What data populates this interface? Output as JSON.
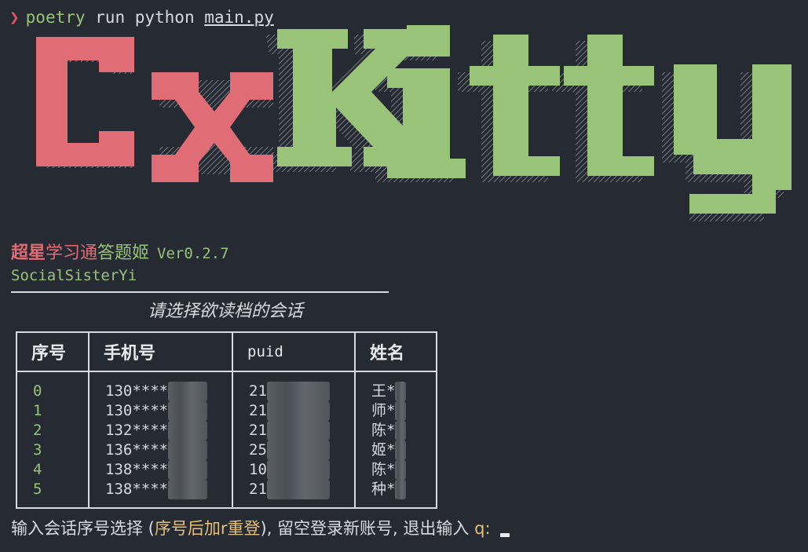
{
  "command": {
    "prompt_glyph": "❯",
    "poetry": "poetry",
    "rest": " run python ",
    "file": "main.py"
  },
  "banner": {
    "word_left": "Cx",
    "word_right": "Kitty",
    "color_left": "#e06c75",
    "color_right": "#98c379"
  },
  "app": {
    "title_part1": "超星",
    "title_part2": "学习通",
    "title_part3": "答题姬",
    "version": "Ver0.2.7",
    "author": "SocialSisterYi"
  },
  "table": {
    "caption": "请选择欲读档的会话",
    "headers": [
      "序号",
      "手机号",
      "puid",
      "姓名"
    ],
    "rows": [
      {
        "index": "0",
        "phone": "130****",
        "puid": "21",
        "name": "王*"
      },
      {
        "index": "1",
        "phone": "130****",
        "puid": "21",
        "name": "师*"
      },
      {
        "index": "2",
        "phone": "132****",
        "puid": "21",
        "name": "陈*"
      },
      {
        "index": "3",
        "phone": "136****",
        "puid": "25",
        "name": "姬*"
      },
      {
        "index": "4",
        "phone": "138****",
        "puid": "10",
        "name": "陈*"
      },
      {
        "index": "5",
        "phone": "138****",
        "puid": "21",
        "name": "种*"
      }
    ]
  },
  "input": {
    "prefix": "输入会话序号选择 (",
    "highlight": "序号后加r重登",
    "middle": "), 留空登录新账号, 退出输入 ",
    "quit_key": "q",
    "suffix": ": "
  }
}
